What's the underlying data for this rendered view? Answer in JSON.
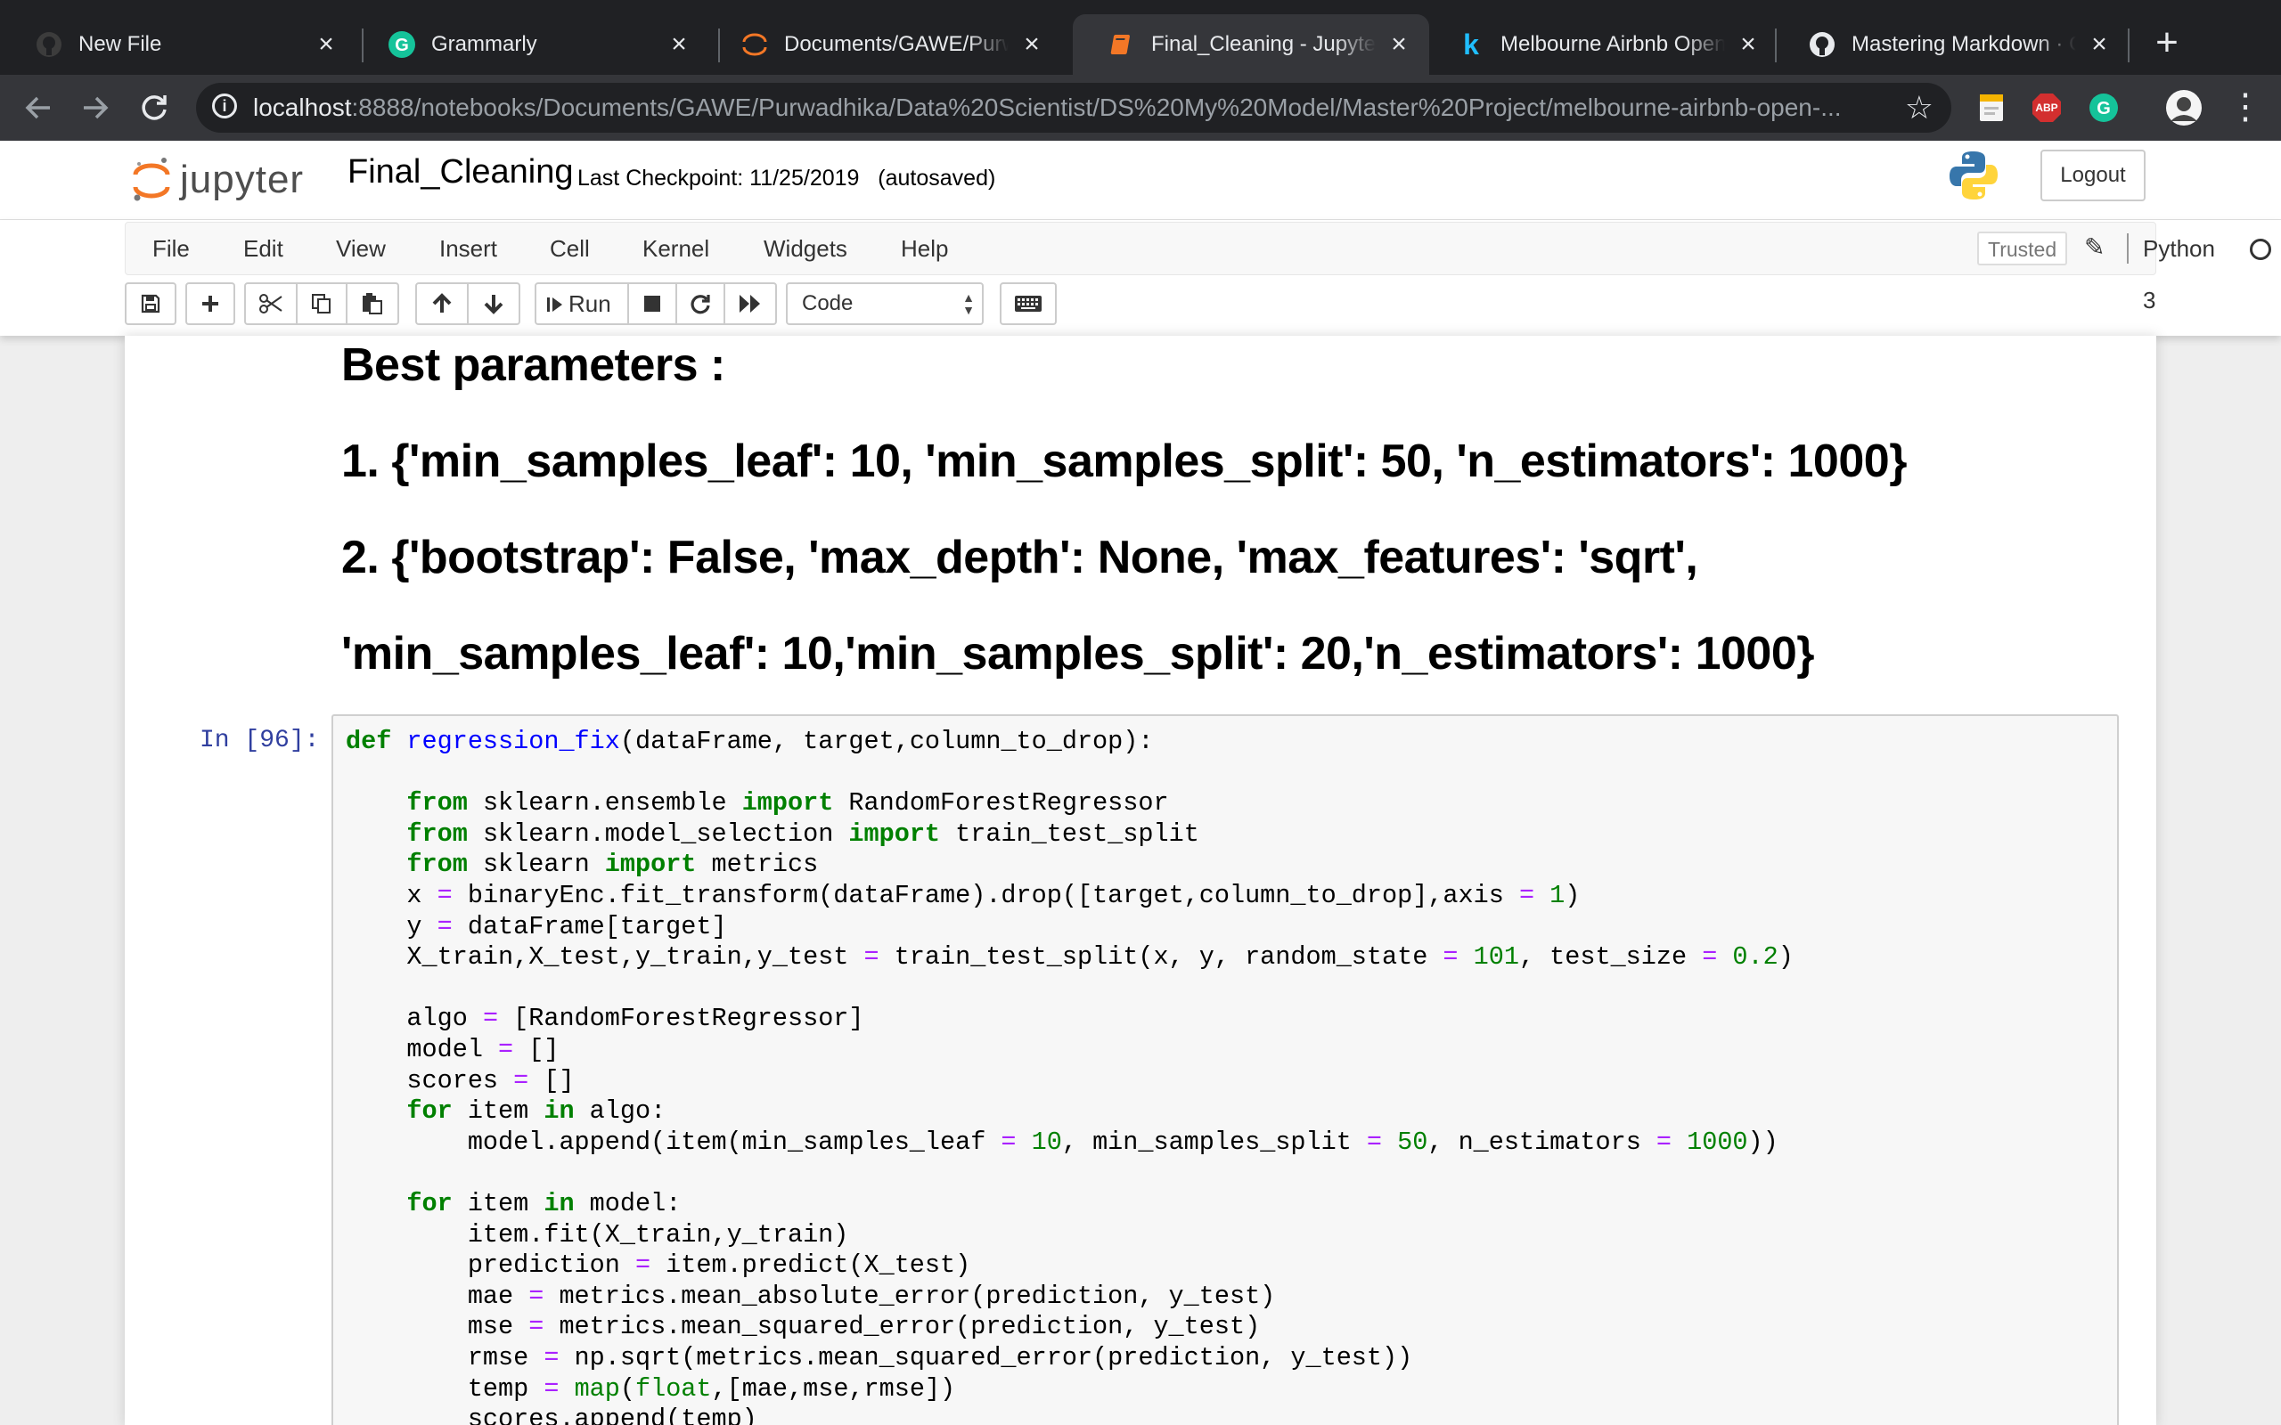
{
  "browser": {
    "tabs": [
      {
        "title": "New File",
        "icon": "github-icon",
        "active": false
      },
      {
        "title": "Grammarly",
        "icon": "grammarly-icon",
        "active": false
      },
      {
        "title": "Documents/GAWE/Purwadhika",
        "icon": "jupyter-icon",
        "active": false
      },
      {
        "title": "Final_Cleaning - Jupyter Notebook",
        "icon": "notebook-icon",
        "active": true
      },
      {
        "title": "Melbourne Airbnb Open Data",
        "icon": "kaggle-icon",
        "active": false
      },
      {
        "title": "Mastering Markdown · GitHub",
        "icon": "github-icon",
        "active": false
      }
    ],
    "url_host": "localhost",
    "url_rest": ":8888/notebooks/Documents/GAWE/Purwadhika/Data%20Scientist/DS%20My%20Model/Master%20Project/melbourne-airbnb-open-...",
    "extensions": [
      "google-keep-icon",
      "adblock-plus-icon",
      "grammarly-ext-icon",
      "profile-avatar"
    ],
    "adblock_label": "ABP",
    "kaggle_letter": "k",
    "new_tab": "+"
  },
  "jupyter": {
    "logo_text": "jupyter",
    "notebook_name": "Final_Cleaning",
    "checkpoint": "Last Checkpoint: 11/25/2019",
    "autosave": "(autosaved)",
    "logout_label": "Logout",
    "menu": [
      "File",
      "Edit",
      "View",
      "Insert",
      "Cell",
      "Kernel",
      "Widgets",
      "Help"
    ],
    "trusted_label": "Trusted",
    "kernel_name": "Python 3",
    "toolbar": {
      "run_label": "Run",
      "cell_type": "Code"
    }
  },
  "markdown": {
    "heading": "Best parameters :",
    "line1": "1. {'min_samples_leaf': 10, 'min_samples_split': 50, 'n_estimators': 1000}",
    "line2": "2. {'bootstrap': False, 'max_depth': None, 'max_features': 'sqrt',",
    "line3": "'min_samples_leaf': 10,'min_samples_split': 20,'n_estimators': 1000}"
  },
  "code_cell": {
    "prompt": "In [96]:",
    "lines": [
      "def regression_fix(dataFrame, target,column_to_drop):",
      "",
      "    from sklearn.ensemble import RandomForestRegressor",
      "    from sklearn.model_selection import train_test_split",
      "    from sklearn import metrics",
      "    x = binaryEnc.fit_transform(dataFrame).drop([target,column_to_drop],axis = 1)",
      "    y = dataFrame[target]",
      "    X_train,X_test,y_train,y_test = train_test_split(x, y, random_state = 101, test_size = 0.2)",
      "",
      "    algo = [RandomForestRegressor]",
      "    model = []",
      "    scores = []",
      "    for item in algo:",
      "        model.append(item(min_samples_leaf = 10, min_samples_split = 50, n_estimators = 1000))",
      "",
      "    for item in model:",
      "        item.fit(X_train,y_train)",
      "        prediction = item.predict(X_test)",
      "        mae = metrics.mean_absolute_error(prediction, y_test)",
      "        mse = metrics.mean_squared_error(prediction, y_test)",
      "        rmse = np.sqrt(metrics.mean_squared_error(prediction, y_test))",
      "        temp = map(float,[mae,mse,rmse])",
      "        scores.append(temp)"
    ]
  },
  "colors": {
    "tab_strip": "#202124",
    "active_tab": "#35363a",
    "keyword": "#008000",
    "function_name": "#0000ff",
    "operator": "#aa22ff",
    "prompt": "#303f9f"
  }
}
